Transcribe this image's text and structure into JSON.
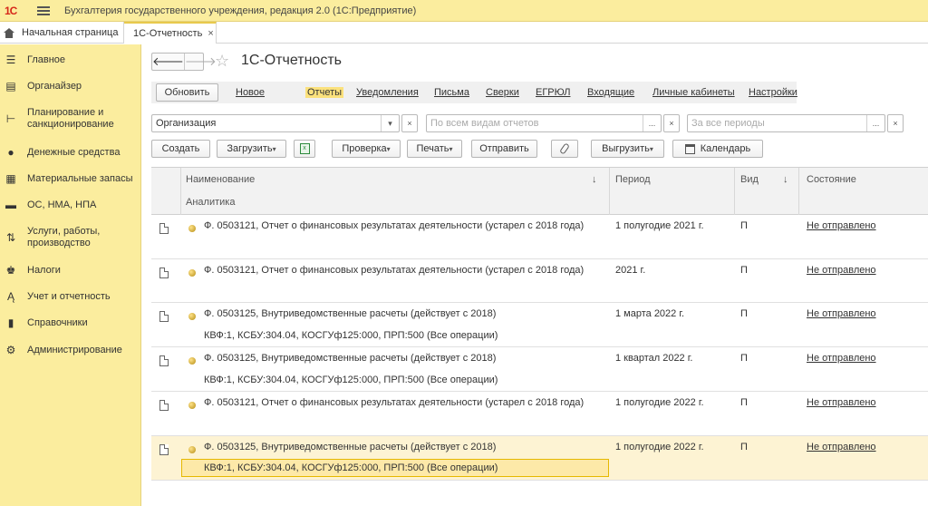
{
  "titlebar": {
    "logo_text": "1С",
    "app_title": "Бухгалтерия государственного учреждения, редакция 2.0  (1С:Предприятие)"
  },
  "tabs": {
    "home_label": "Начальная страница",
    "active_label": "1С-Отчетность",
    "close_glyph": "×"
  },
  "sidebar": {
    "items": [
      {
        "label": "Главное",
        "icon": "menu-icon"
      },
      {
        "label": "Органайзер",
        "icon": "organizer-icon"
      },
      {
        "label": "Планирование и санкционирование",
        "icon": "planning-icon"
      },
      {
        "label": "Денежные средства",
        "icon": "money-icon"
      },
      {
        "label": "Материальные запасы",
        "icon": "inventory-icon"
      },
      {
        "label": "ОС, НМА, НПА",
        "icon": "truck-icon"
      },
      {
        "label": "Услуги, работы, производство",
        "icon": "services-icon"
      },
      {
        "label": "Налоги",
        "icon": "taxes-icon"
      },
      {
        "label": "Учет и отчетность",
        "icon": "reporting-icon"
      },
      {
        "label": "Справочники",
        "icon": "directories-icon"
      },
      {
        "label": "Администрирование",
        "icon": "gear-icon"
      }
    ]
  },
  "header": {
    "title": "1С-Отчетность",
    "back_glyph": "🡐",
    "forward_glyph": "🡒",
    "star_glyph": "☆"
  },
  "nav": {
    "refresh": "Обновить",
    "links": [
      "Новое",
      "Отчеты",
      "Уведомления",
      "Письма",
      "Сверки",
      "ЕГРЮЛ",
      "Входящие",
      "Личные кабинеты",
      "Настройки"
    ],
    "active": "Отчеты"
  },
  "filters": {
    "organization_value": "Организация",
    "report_types_placeholder": "По всем видам отчетов",
    "periods_placeholder": "За все периоды"
  },
  "toolbar": {
    "create": "Создать",
    "upload": "Загрузить",
    "check": "Проверка",
    "print": "Печать",
    "send": "Отправить",
    "export": "Выгрузить",
    "calendar": "Календарь"
  },
  "table": {
    "columns": {
      "name": "Наименование",
      "analytics": "Аналитика",
      "period": "Период",
      "kind": "Вид",
      "status": "Состояние",
      "sort_glyph": "↓"
    },
    "rows": [
      {
        "name": "Ф. 0503121, Отчет о финансовых результатах деятельности (устарел с 2018 года)",
        "analytics": "",
        "period": "1 полугодие 2021 г.",
        "kind": "П",
        "status": "Не отправлено"
      },
      {
        "name": "Ф. 0503121, Отчет о финансовых результатах деятельности (устарел с 2018 года)",
        "analytics": "",
        "period": "2021 г.",
        "kind": "П",
        "status": "Не отправлено"
      },
      {
        "name": "Ф. 0503125, Внутриведомственные расчеты (действует с 2018)",
        "analytics": "КВФ:1, КСБУ:304.04, КОСГУф125:000, ПРП:500 (Все операции)",
        "period": "1 марта 2022 г.",
        "kind": "П",
        "status": "Не отправлено"
      },
      {
        "name": "Ф. 0503125, Внутриведомственные расчеты (действует с 2018)",
        "analytics": "КВФ:1, КСБУ:304.04, КОСГУф125:000, ПРП:500 (Все операции)",
        "period": "1 квартал 2022 г.",
        "kind": "П",
        "status": "Не отправлено"
      },
      {
        "name": "Ф. 0503121, Отчет о финансовых результатах деятельности (устарел с 2018 года)",
        "analytics": "",
        "period": "1 полугодие 2022 г.",
        "kind": "П",
        "status": "Не отправлено"
      },
      {
        "name": "Ф. 0503125, Внутриведомственные расчеты (действует с 2018)",
        "analytics": "КВФ:1, КСБУ:304.04, КОСГУф125:000, ПРП:500 (Все операции)",
        "period": "1 полугодие 2022 г.",
        "kind": "П",
        "status": "Не отправлено"
      }
    ]
  },
  "colors": {
    "accent_yellow": "#fbed9e",
    "selected_row": "#fdf3d3",
    "active_link": "#fbe17c"
  }
}
